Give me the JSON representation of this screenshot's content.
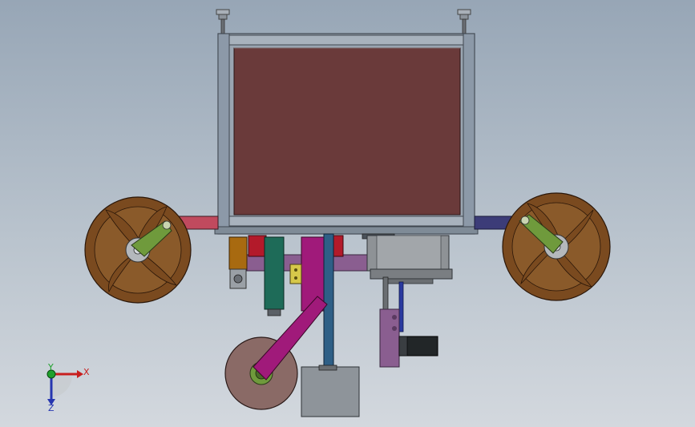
{
  "triad": {
    "x_label": "X",
    "y_label": "Y",
    "z_label": "Z"
  },
  "colors": {
    "frame": "#8c99a8",
    "frame_dark": "#5c6773",
    "panel": "#6a3a3a",
    "wheel": "#7a4a1f",
    "wheel_arm": "#6f9a3c",
    "arm_magenta": "#a01a7a",
    "disc": "#8a6a66",
    "motor_gray": "#8e9296",
    "green_column": "#1e6b58",
    "purple_bar": "#8a5e90",
    "blue_bar": "#2e5f86",
    "x_axis": "#c81e1e",
    "y_axis": "#1fa02c",
    "z_axis": "#2636b0"
  },
  "icons": [
    "leveling-foot-icon",
    "coordinate-triad-icon"
  ]
}
